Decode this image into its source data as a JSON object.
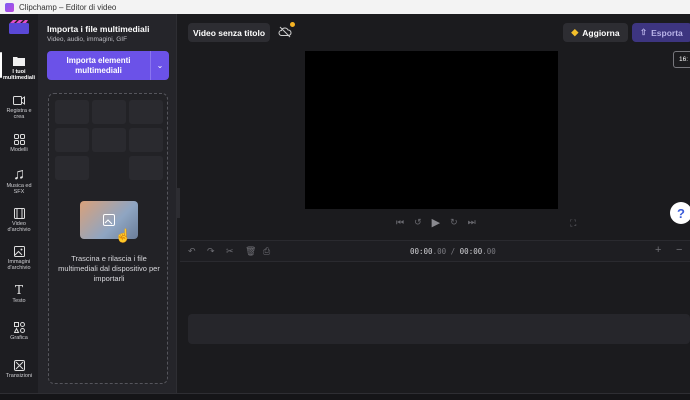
{
  "window": {
    "title": "Clipchamp – Editor di video"
  },
  "sidebar": {
    "items": [
      {
        "label": "I tuoi multimediali",
        "icon": "folder-icon",
        "active": true
      },
      {
        "label": "Registra e crea",
        "icon": "camera-icon",
        "active": false
      },
      {
        "label": "Modelli",
        "icon": "templates-icon",
        "active": false
      },
      {
        "label": "Musica ed SFX",
        "icon": "music-icon",
        "active": false
      },
      {
        "label": "Video d'archivio",
        "icon": "film-icon",
        "active": false
      },
      {
        "label": "Immagini d'archivio",
        "icon": "image-icon",
        "active": false
      },
      {
        "label": "Testo",
        "icon": "text-icon",
        "active": false
      },
      {
        "label": "Grafica",
        "icon": "graphics-icon",
        "active": false
      },
      {
        "label": "Transizioni",
        "icon": "transitions-icon",
        "active": false
      }
    ]
  },
  "media_panel": {
    "title": "Importa i file multimediali",
    "subtitle": "Video, audio, immagini, GIF",
    "import_button": "Importa elementi multimediali",
    "drop_text": "Trascina e rilascia i file multimediali dal dispositivo per importarli"
  },
  "header": {
    "video_title": "Video senza titolo",
    "upgrade_label": "Aggiorna",
    "export_label": "Esporta",
    "aspect_ratio": "16:"
  },
  "timeline": {
    "current_time": "00:00",
    "current_frac": ".00",
    "separator": " / ",
    "total_time": "00:00",
    "total_frac": ".00"
  },
  "help": {
    "label": "?"
  },
  "colors": {
    "accent": "#6b52e8",
    "premium": "#f5c02b",
    "background": "#1b1b1e"
  }
}
